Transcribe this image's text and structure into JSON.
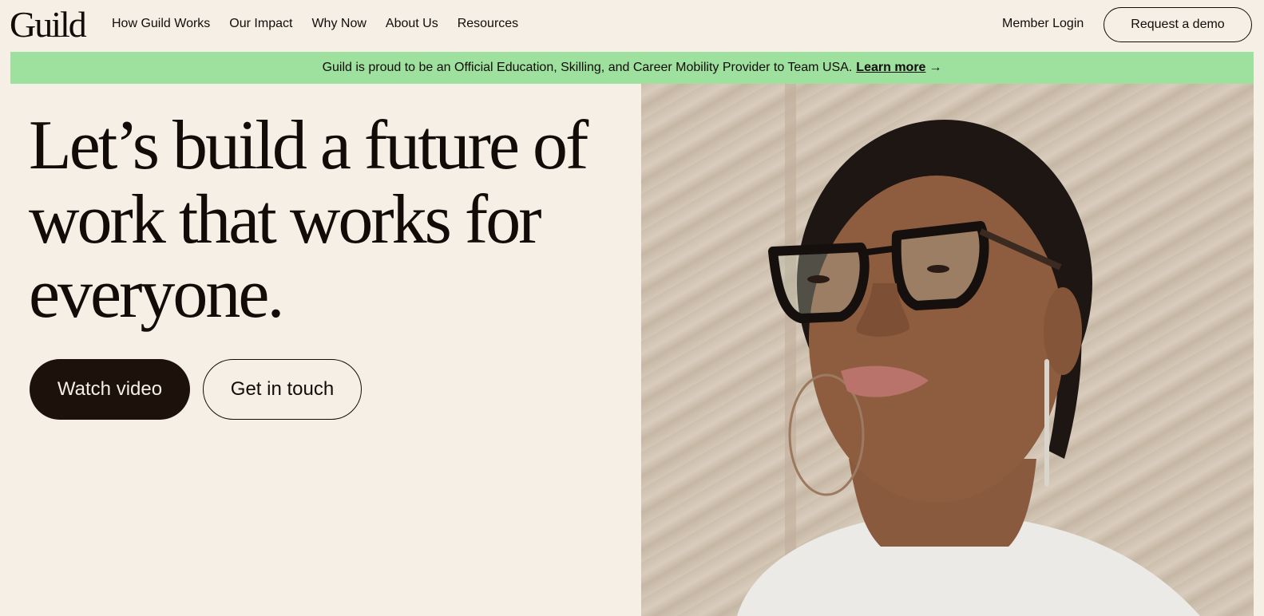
{
  "header": {
    "logo": "Guild",
    "nav": [
      "How Guild Works",
      "Our Impact",
      "Why Now",
      "About Us",
      "Resources"
    ],
    "member_login": "Member Login",
    "request_demo": "Request a demo"
  },
  "banner": {
    "text": "Guild is proud to be an Official Education, Skilling, and Career Mobility Provider to Team USA.",
    "link": "Learn more",
    "arrow_icon": "arrow-right-icon",
    "color": "#9ee09e"
  },
  "hero": {
    "title": "Let’s build a future of work that works for everyone.",
    "watch_video": "Watch video",
    "get_in_touch": "Get in touch"
  },
  "colors": {
    "background": "#f6efe6",
    "primary_button": "#1c110b",
    "text": "#120c08"
  }
}
